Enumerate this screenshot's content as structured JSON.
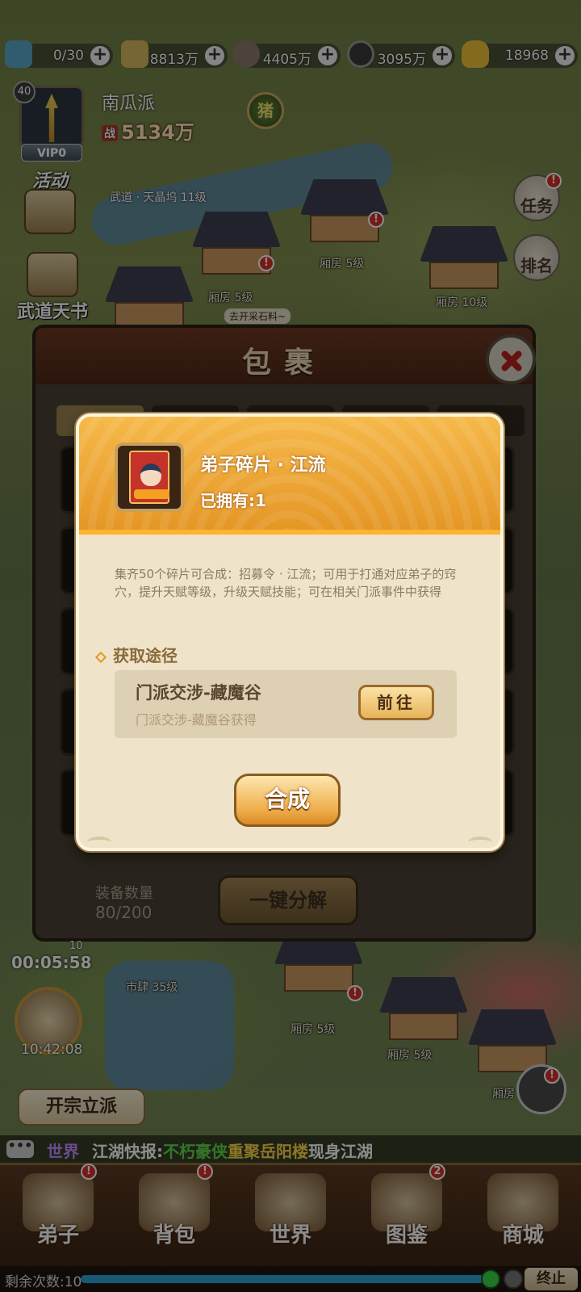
{
  "colors": {
    "popup_accent": "#e49524",
    "craft_button": "#efae4a",
    "notification": "#d63128",
    "world_channel": "#c48cff"
  },
  "resources": [
    {
      "icon": "energy-icon",
      "value": "0/30"
    },
    {
      "icon": "paper-icon",
      "value": "8813万"
    },
    {
      "icon": "ore-icon",
      "value": "4405万"
    },
    {
      "icon": "coin-icon",
      "value": "3095万"
    },
    {
      "icon": "gold-ingot-icon",
      "value": "18968"
    }
  ],
  "player": {
    "level": "40",
    "vip": "VIP0",
    "sect_name": "南瓜派",
    "power_tag": "战",
    "power": "5134万",
    "pig_button": "猪",
    "location": "武道 · 天晶坞  11级"
  },
  "side_buttons": {
    "activity": "活动",
    "martial_book": "武道天书"
  },
  "right_buttons": {
    "task": "任务",
    "rank": "排名"
  },
  "buildings": [
    {
      "label": "厢房  5级"
    },
    {
      "label": "厢房  5级"
    },
    {
      "label": "厢房  10级"
    },
    {
      "label": "去开采石料~"
    },
    {
      "label": "市肆  35级"
    },
    {
      "label": "厢房  5级"
    },
    {
      "label": "厢房  5级"
    },
    {
      "label": "厢房"
    }
  ],
  "inventory": {
    "title": "包裹",
    "equip_count_label": "装备数量",
    "equip_count": "80/200",
    "decompose_button": "一键分解"
  },
  "item_popup": {
    "name": "弟子碎片 · 江流",
    "owned": "已拥有:1",
    "description": "集齐50个碎片可合成：招募令 · 江流；可用于打通对应弟子的窍穴，提升天赋等级，升级天赋技能；可在相关门派事件中获得",
    "source_title": "获取途径",
    "source": {
      "name": "门派交涉-藏魔谷",
      "desc": "门派交涉-藏魔谷获得",
      "goto_button": "前往"
    },
    "craft_button": "合成"
  },
  "bottom": {
    "timer1_badge": "10",
    "timer1": "00:05:58",
    "timer2": "10:42:08",
    "found_sect_button": "开宗立派"
  },
  "ticker": {
    "chat_icon": "•••",
    "channel": "世界",
    "parts": [
      "江湖快报:",
      "不朽豪侠",
      "重聚岳阳楼",
      "现身江湖"
    ]
  },
  "nav": [
    {
      "label": "弟子",
      "icon": "disciple-icon",
      "badge": "!"
    },
    {
      "label": "背包",
      "icon": "backpack-icon",
      "badge": "!"
    },
    {
      "label": "世界",
      "icon": "world-map-icon",
      "badge": ""
    },
    {
      "label": "图鉴",
      "icon": "codex-icon",
      "badge": "2"
    },
    {
      "label": "商城",
      "icon": "shop-icon",
      "badge": ""
    }
  ],
  "status": {
    "remaining": "剩余次数:10",
    "end_button": "终止",
    "progress": 1.0
  }
}
